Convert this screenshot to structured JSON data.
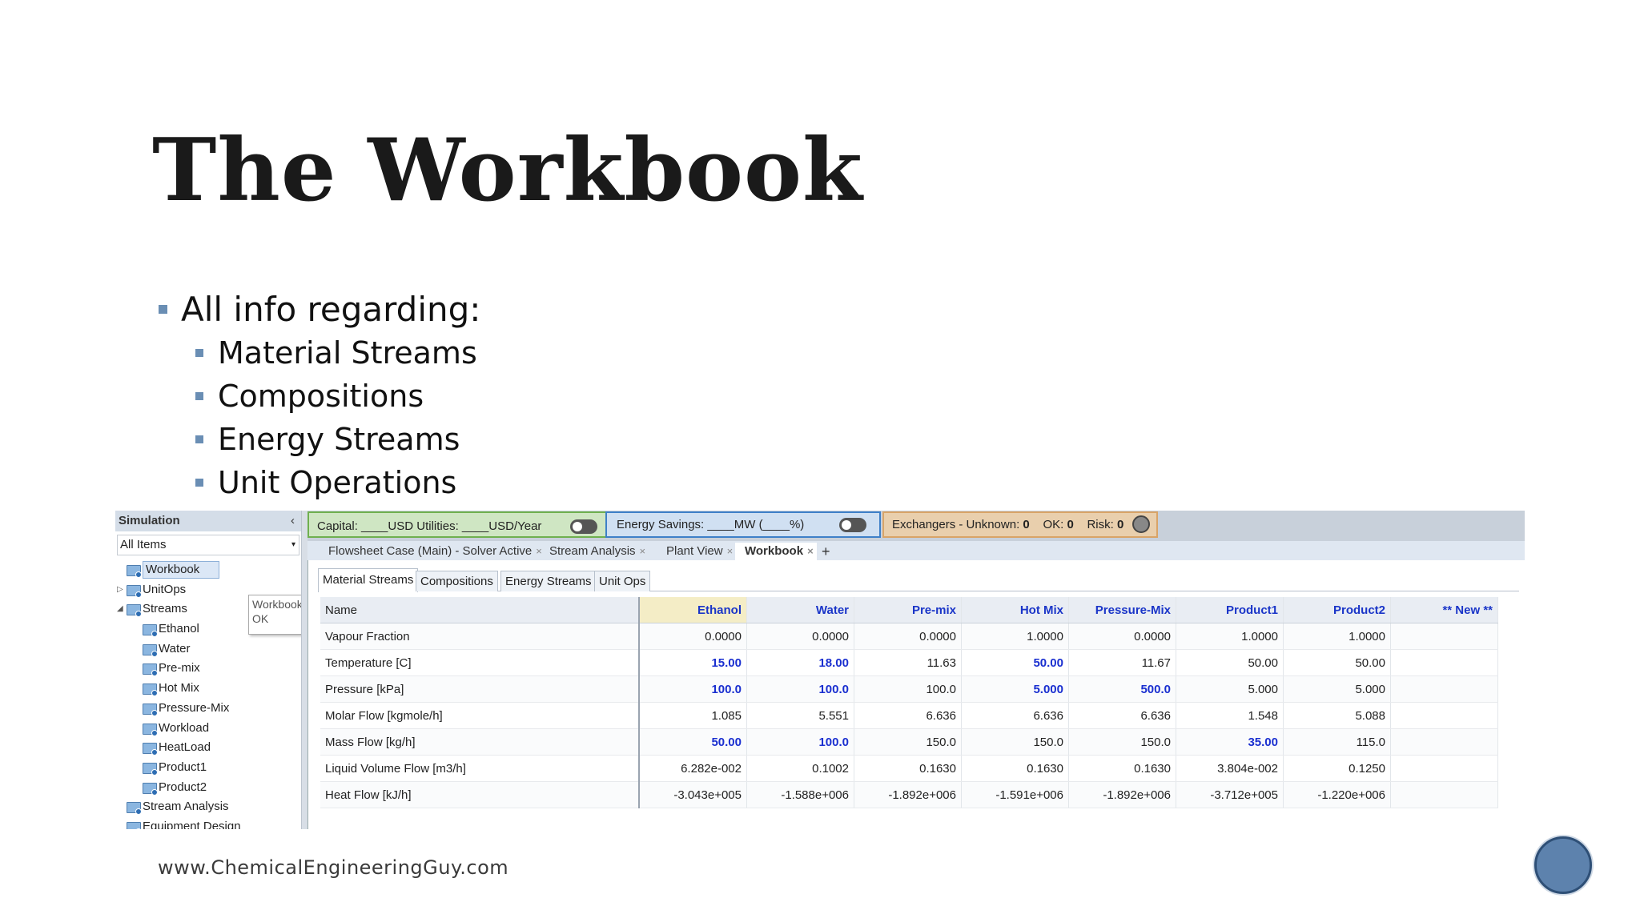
{
  "slide": {
    "title": "The Workbook",
    "bullet_main": "All info regarding:",
    "bullets": [
      "Material Streams",
      "Compositions",
      "Energy Streams",
      "Unit Operations"
    ],
    "footer": "www.ChemicalEngineeringGuy.com"
  },
  "sidebar": {
    "header": "Simulation",
    "collapse_glyph": "‹",
    "filter": "All Items",
    "tree": [
      {
        "label": "Workbook",
        "indent": 1,
        "selected": true
      },
      {
        "label": "UnitOps",
        "indent": 1,
        "expander": "▷"
      },
      {
        "label": "Streams",
        "indent": 1,
        "expander": "◢"
      },
      {
        "label": "Ethanol",
        "indent": 2
      },
      {
        "label": "Water",
        "indent": 2
      },
      {
        "label": "Pre-mix",
        "indent": 2
      },
      {
        "label": "Hot Mix",
        "indent": 2
      },
      {
        "label": "Pressure-Mix",
        "indent": 2
      },
      {
        "label": "Workload",
        "indent": 2
      },
      {
        "label": "HeatLoad",
        "indent": 2
      },
      {
        "label": "Product1",
        "indent": 2
      },
      {
        "label": "Product2",
        "indent": 2
      },
      {
        "label": "Stream Analysis",
        "indent": 1
      },
      {
        "label": "Equipment Design",
        "indent": 1
      }
    ],
    "tooltip": {
      "line1": "Workbook",
      "line2": "OK"
    }
  },
  "toolbar": {
    "capital": "Capital: ____USD   Utilities: ____USD/Year",
    "energy": "Energy Savings: ____MW    (____%)",
    "exchangers": {
      "label_unknown": "Exchangers - Unknown:",
      "unknown": "0",
      "label_ok": "OK:",
      "ok": "0",
      "label_risk": "Risk:",
      "risk": "0"
    }
  },
  "doc_tabs": [
    {
      "label": "Flowsheet Case (Main) - Solver Active",
      "close": "×"
    },
    {
      "label": "Stream Analysis",
      "close": "×"
    },
    {
      "label": "Plant View",
      "close": "×"
    },
    {
      "label": "Workbook",
      "close": "×",
      "active": true
    }
  ],
  "doc_tab_add": "+",
  "inner_tabs": [
    "Material Streams",
    "Compositions",
    "Energy Streams",
    "Unit Ops"
  ],
  "table": {
    "header_name": "Name",
    "columns": [
      "Ethanol",
      "Water",
      "Pre-mix",
      "Hot Mix",
      "Pressure-Mix",
      "Product1",
      "Product2",
      "** New **"
    ],
    "rows": [
      {
        "name": "Vapour Fraction",
        "values": [
          "0.0000",
          "0.0000",
          "0.0000",
          "1.0000",
          "0.0000",
          "1.0000",
          "1.0000",
          ""
        ],
        "spec": []
      },
      {
        "name": "Temperature [C]",
        "values": [
          "15.00",
          "18.00",
          "11.63",
          "50.00",
          "11.67",
          "50.00",
          "50.00",
          ""
        ],
        "spec": [
          0,
          1,
          3
        ]
      },
      {
        "name": "Pressure [kPa]",
        "values": [
          "100.0",
          "100.0",
          "100.0",
          "5.000",
          "500.0",
          "5.000",
          "5.000",
          ""
        ],
        "spec": [
          0,
          1,
          3,
          4
        ]
      },
      {
        "name": "Molar Flow [kgmole/h]",
        "values": [
          "1.085",
          "5.551",
          "6.636",
          "6.636",
          "6.636",
          "1.548",
          "5.088",
          ""
        ],
        "spec": []
      },
      {
        "name": "Mass Flow [kg/h]",
        "values": [
          "50.00",
          "100.0",
          "150.0",
          "150.0",
          "150.0",
          "35.00",
          "115.0",
          ""
        ],
        "spec": [
          0,
          1,
          5
        ]
      },
      {
        "name": "Liquid Volume Flow [m3/h]",
        "values": [
          "6.282e-002",
          "0.1002",
          "0.1630",
          "0.1630",
          "0.1630",
          "3.804e-002",
          "0.1250",
          ""
        ],
        "spec": []
      },
      {
        "name": "Heat Flow [kJ/h]",
        "values": [
          "-3.043e+005",
          "-1.588e+006",
          "-1.892e+006",
          "-1.591e+006",
          "-1.892e+006",
          "-3.712e+005",
          "-1.220e+006",
          ""
        ],
        "spec": []
      }
    ]
  }
}
